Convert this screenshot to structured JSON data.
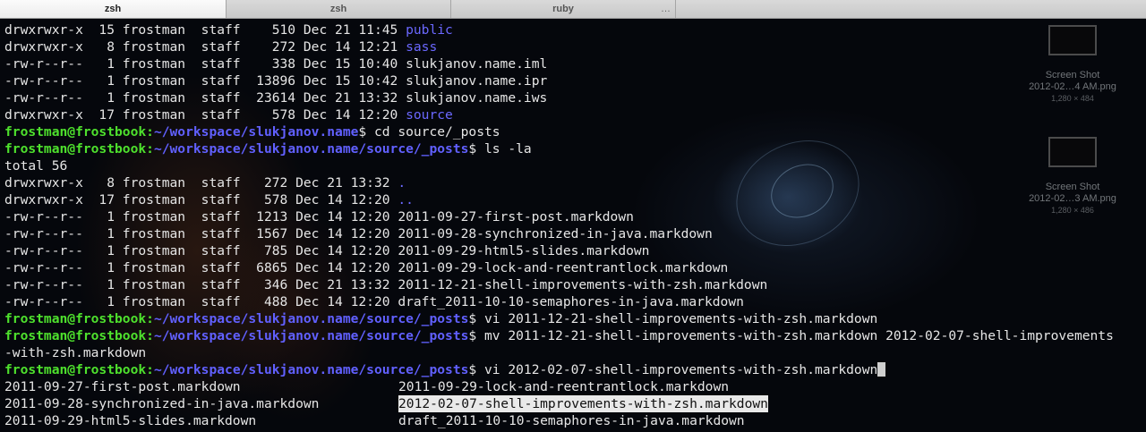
{
  "tabs": [
    {
      "label": "zsh",
      "active": true
    },
    {
      "label": "zsh",
      "active": false
    },
    {
      "label": "ruby",
      "active": false,
      "overflow": "…"
    }
  ],
  "desktop_icons": [
    {
      "name": "Screen Shot\n2012-02…4 AM.png",
      "name_line1": "Screen Shot",
      "name_line2": "2012-02…4 AM.png",
      "size": "1,280 × 484"
    },
    {
      "name_line1": "Screen Shot",
      "name_line2": "2012-02…3 AM.png",
      "size": "1,280 × 486"
    }
  ],
  "prompt": {
    "user": "frostman@frostbook",
    "sep": ":"
  },
  "lines": [
    {
      "type": "ls",
      "meta": "drwxrwxr-x  15 frostman  staff    510 Dec 21 11:45 ",
      "name": "public",
      "dir": true
    },
    {
      "type": "ls",
      "meta": "drwxrwxr-x   8 frostman  staff    272 Dec 14 12:21 ",
      "name": "sass",
      "dir": true
    },
    {
      "type": "ls",
      "meta": "-rw-r--r--   1 frostman  staff    338 Dec 15 10:40 ",
      "name": "slukjanov.name.iml",
      "dir": false
    },
    {
      "type": "ls",
      "meta": "-rw-r--r--   1 frostman  staff  13896 Dec 15 10:42 ",
      "name": "slukjanov.name.ipr",
      "dir": false
    },
    {
      "type": "ls",
      "meta": "-rw-r--r--   1 frostman  staff  23614 Dec 21 13:32 ",
      "name": "slukjanov.name.iws",
      "dir": false
    },
    {
      "type": "ls",
      "meta": "drwxrwxr-x  17 frostman  staff    578 Dec 14 12:20 ",
      "name": "source",
      "dir": true
    },
    {
      "type": "prompt",
      "path": "~/workspace/slukjanov.name",
      "cmd": "$ cd source/_posts"
    },
    {
      "type": "prompt",
      "path": "~/workspace/slukjanov.name/source/_posts",
      "cmd": "$ ls -la"
    },
    {
      "type": "text",
      "text": "total 56"
    },
    {
      "type": "ls",
      "meta": "drwxrwxr-x   8 frostman  staff   272 Dec 21 13:32 ",
      "name": ".",
      "dir": true
    },
    {
      "type": "ls",
      "meta": "drwxrwxr-x  17 frostman  staff   578 Dec 14 12:20 ",
      "name": "..",
      "dir": true
    },
    {
      "type": "ls",
      "meta": "-rw-r--r--   1 frostman  staff  1213 Dec 14 12:20 ",
      "name": "2011-09-27-first-post.markdown",
      "dir": false
    },
    {
      "type": "ls",
      "meta": "-rw-r--r--   1 frostman  staff  1567 Dec 14 12:20 ",
      "name": "2011-09-28-synchronized-in-java.markdown",
      "dir": false
    },
    {
      "type": "ls",
      "meta": "-rw-r--r--   1 frostman  staff   785 Dec 14 12:20 ",
      "name": "2011-09-29-html5-slides.markdown",
      "dir": false
    },
    {
      "type": "ls",
      "meta": "-rw-r--r--   1 frostman  staff  6865 Dec 14 12:20 ",
      "name": "2011-09-29-lock-and-reentrantlock.markdown",
      "dir": false
    },
    {
      "type": "ls",
      "meta": "-rw-r--r--   1 frostman  staff   346 Dec 21 13:32 ",
      "name": "2011-12-21-shell-improvements-with-zsh.markdown",
      "dir": false
    },
    {
      "type": "ls",
      "meta": "-rw-r--r--   1 frostman  staff   488 Dec 14 12:20 ",
      "name": "draft_2011-10-10-semaphores-in-java.markdown",
      "dir": false
    },
    {
      "type": "prompt",
      "path": "~/workspace/slukjanov.name/source/_posts",
      "cmd": "$ vi 2011-12-21-shell-improvements-with-zsh.markdown"
    },
    {
      "type": "prompt",
      "path": "~/workspace/slukjanov.name/source/_posts",
      "cmd": "$ mv 2011-12-21-shell-improvements-with-zsh.markdown 2012-02-07-shell-improvements"
    },
    {
      "type": "text",
      "text": "-with-zsh.markdown"
    },
    {
      "type": "prompt",
      "path": "~/workspace/slukjanov.name/source/_posts",
      "cmd": "$ vi 2012-02-07-shell-improvements-with-zsh.markdown",
      "cursor": true
    }
  ],
  "completions": [
    {
      "left": "2011-09-27-first-post.markdown",
      "right": "2011-09-29-lock-and-reentrantlock.markdown",
      "right_selected": false
    },
    {
      "left": "2011-09-28-synchronized-in-java.markdown",
      "right": "2012-02-07-shell-improvements-with-zsh.markdown",
      "right_selected": true
    },
    {
      "left": "2011-09-29-html5-slides.markdown",
      "right": "draft_2011-10-10-semaphores-in-java.markdown",
      "right_selected": false
    }
  ],
  "colors": {
    "user": "#4ee12d",
    "path": "#6160ff",
    "dir": "#6b68ff",
    "text": "#e6e6e6"
  }
}
